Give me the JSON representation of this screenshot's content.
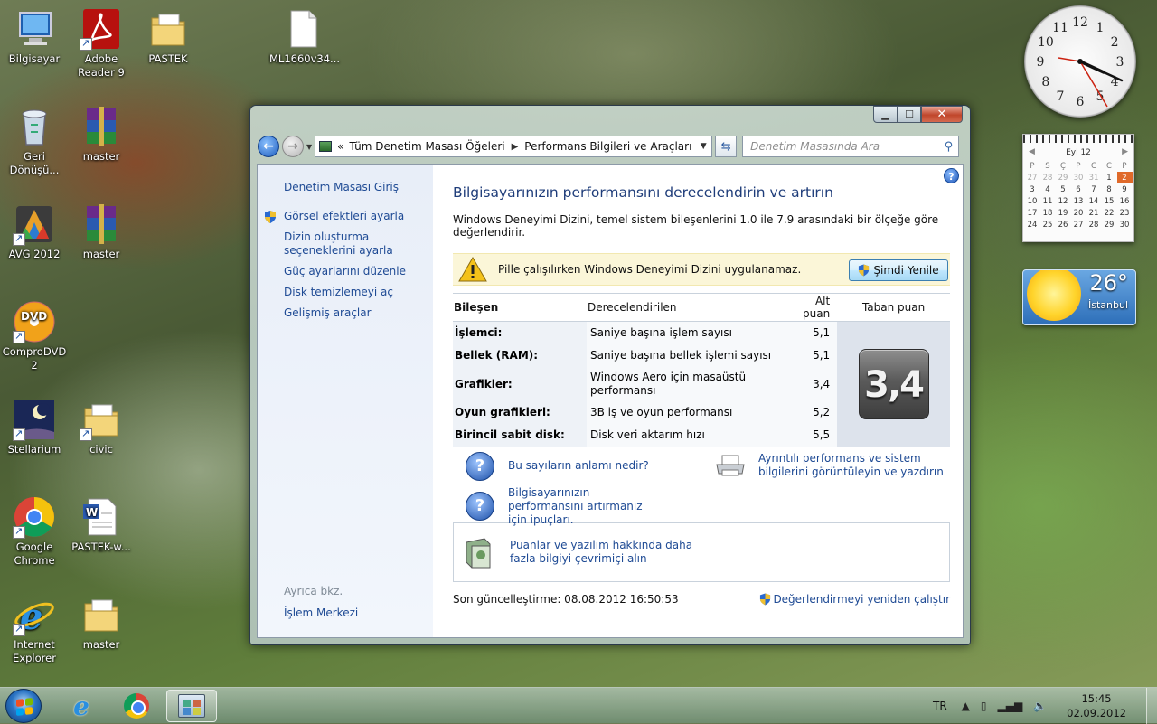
{
  "desktop": {
    "icons": [
      {
        "label": "Bilgisayar"
      },
      {
        "label": "Adobe Reader 9"
      },
      {
        "label": "PASTEK"
      },
      {
        "label": "ML1660v34..."
      },
      {
        "label": "Geri Dönüşü..."
      },
      {
        "label": "master"
      },
      {
        "label": "AVG 2012"
      },
      {
        "label": "master"
      },
      {
        "label": "ComproDVD 2"
      },
      {
        "label": "Stellarium"
      },
      {
        "label": "civic"
      },
      {
        "label": "Google Chrome"
      },
      {
        "label": "PASTEK-w..."
      },
      {
        "label": "Internet Explorer"
      },
      {
        "label": "master"
      }
    ]
  },
  "gadgets": {
    "clock_numbers": [
      "12",
      "1",
      "2",
      "3",
      "4",
      "5",
      "6",
      "7",
      "8",
      "9",
      "10",
      "11"
    ],
    "calendar": {
      "month": "Eyl 12",
      "day_headers": [
        "P",
        "S",
        "Ç",
        "P",
        "C",
        "C",
        "P"
      ],
      "rows": [
        [
          "27",
          "28",
          "29",
          "30",
          "31",
          "1",
          "2"
        ],
        [
          "3",
          "4",
          "5",
          "6",
          "7",
          "8",
          "9"
        ],
        [
          "10",
          "11",
          "12",
          "13",
          "14",
          "15",
          "16"
        ],
        [
          "17",
          "18",
          "19",
          "20",
          "21",
          "22",
          "23"
        ],
        [
          "24",
          "25",
          "26",
          "27",
          "28",
          "29",
          "30"
        ]
      ],
      "today": "2"
    },
    "weather": {
      "temp": "26°",
      "city": "İstanbul"
    }
  },
  "window": {
    "address": {
      "crumb1": "Tüm Denetim Masası Öğeleri",
      "crumb2": "Performans Bilgileri ve Araçları"
    },
    "search_placeholder": "Denetim Masasında Ara",
    "sidebar": {
      "home": "Denetim Masası Giriş",
      "links": [
        "Görsel efektleri ayarla",
        "Dizin oluşturma seçeneklerini ayarla",
        "Güç ayarlarını düzenle",
        "Disk temizlemeyi aç",
        "Gelişmiş araçlar"
      ],
      "see_also": "Ayrıca bkz.",
      "action_center": "İşlem Merkezi"
    },
    "main": {
      "title": "Bilgisayarınızın performansını derecelendirin ve artırın",
      "intro": "Windows Deneyimi Dizini, temel sistem bileşenlerini 1.0 ile 7.9 arasındaki bir ölçeğe göre değerlendirir.",
      "warning": "Pille çalışılırken Windows Deneyimi Dizini uygulanamaz.",
      "refresh_now": "Şimdi Yenile",
      "table": {
        "headers": [
          "Bileşen",
          "Derecelendirilen",
          "Alt puan",
          "Taban puan"
        ],
        "rows": [
          {
            "component": "İşlemci:",
            "rated": "Saniye başına işlem sayısı",
            "score": "5,1"
          },
          {
            "component": "Bellek (RAM):",
            "rated": "Saniye başına bellek işlemi sayısı",
            "score": "5,1"
          },
          {
            "component": "Grafikler:",
            "rated": "Windows Aero için masaüstü performansı",
            "score": "3,4"
          },
          {
            "component": "Oyun grafikleri:",
            "rated": "3B iş ve oyun performansı",
            "score": "5,2"
          },
          {
            "component": "Birincil sabit disk:",
            "rated": "Disk veri aktarım hızı",
            "score": "5,5"
          }
        ],
        "base_score": "3,4"
      },
      "links": {
        "meaning": "Bu sayıların anlamı nedir?",
        "tips": "Bilgisayarınızın performansını artırmanız için ipuçları.",
        "details": "Ayrıntılı performans ve sistem bilgilerini görüntüleyin ve yazdırın",
        "online": "Puanlar ve yazılım hakkında daha fazla bilgiyi çevrimiçi alın"
      },
      "last_update": "Son güncelleştirme: 08.08.2012 16:50:53",
      "rerun": "Değerlendirmeyi yeniden çalıştır"
    }
  },
  "taskbar": {
    "lang": "TR",
    "time": "15:45",
    "date": "02.09.2012"
  }
}
